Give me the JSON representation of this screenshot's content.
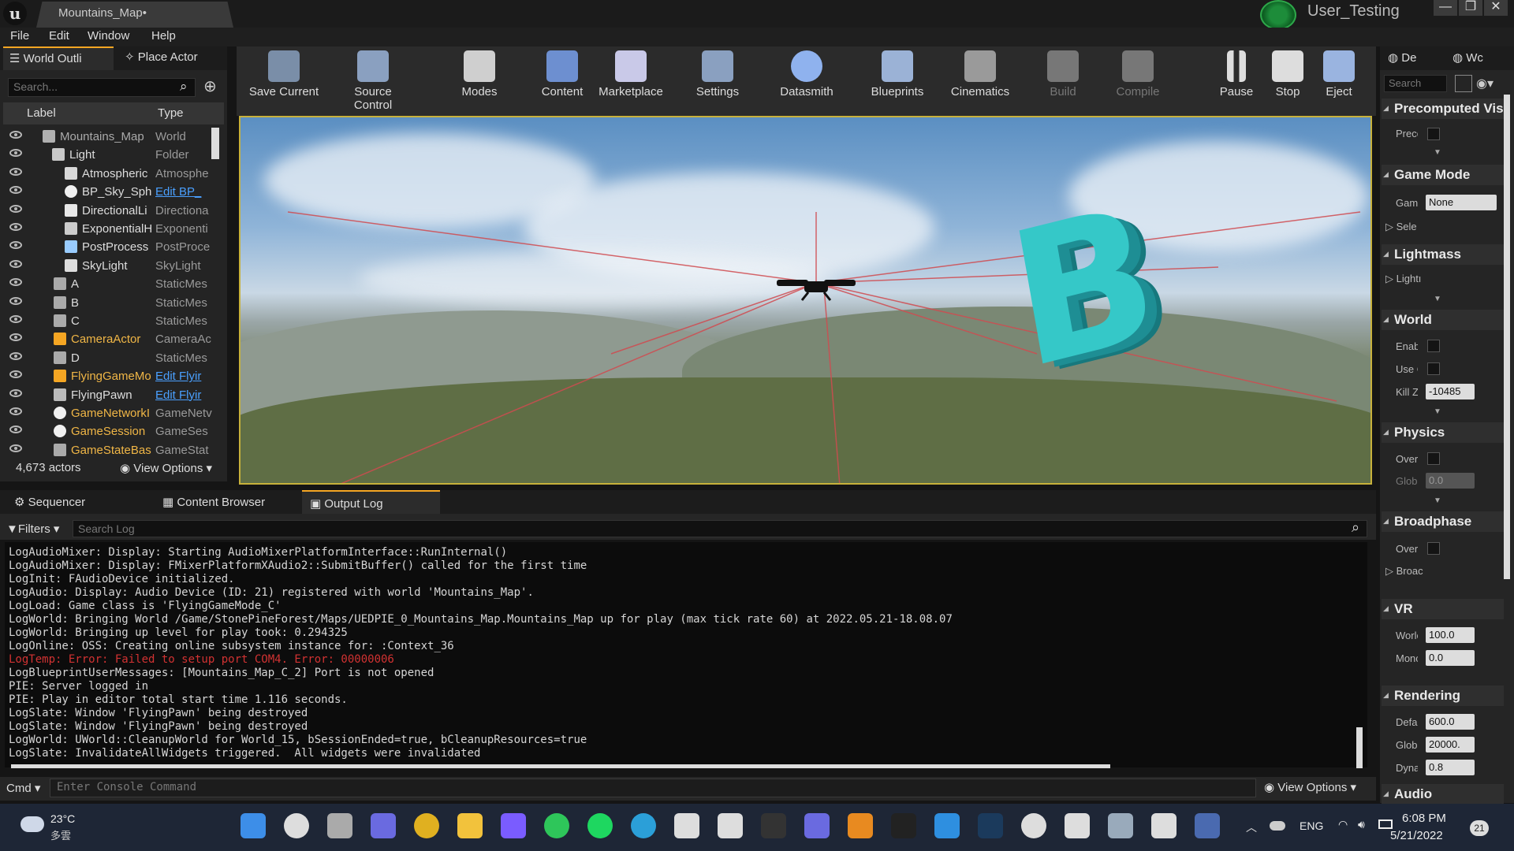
{
  "window": {
    "doc_tab": "Mountains_Map•",
    "user": "User_Testing",
    "minimize": "—",
    "restore": "❐",
    "close": "✕"
  },
  "menu": [
    "File",
    "Edit",
    "Window",
    "Help"
  ],
  "outliner": {
    "tab": "World Outli",
    "tab2": "Place Actor",
    "search_placeholder": "Search...",
    "col_label": "Label",
    "col_type": "Type",
    "rows": [
      {
        "label": "Mountains_Map",
        "type": "World",
        "icon": "world-icon"
      },
      {
        "label": "Light",
        "type": "Folder",
        "icon": "folder-icon"
      },
      {
        "label": "Atmospheric",
        "type": "Atmosphe",
        "icon": "atmosphere-icon"
      },
      {
        "label": "BP_Sky_Sph",
        "type": "Edit BP_",
        "icon": "sphere-icon",
        "link": true
      },
      {
        "label": "DirectionalLi",
        "type": "Directiona",
        "icon": "light-icon"
      },
      {
        "label": "ExponentialH",
        "type": "Exponenti",
        "icon": "fog-icon"
      },
      {
        "label": "PostProcess",
        "type": "PostProce",
        "icon": "postprocess-icon"
      },
      {
        "label": "SkyLight",
        "type": "SkyLight",
        "icon": "skylight-icon"
      },
      {
        "label": "A",
        "type": "StaticMes",
        "icon": "mesh-icon"
      },
      {
        "label": "B",
        "type": "StaticMes",
        "icon": "mesh-icon"
      },
      {
        "label": "C",
        "type": "StaticMes",
        "icon": "mesh-icon"
      },
      {
        "label": "CameraActor",
        "type": "CameraAc",
        "icon": "camera-icon"
      },
      {
        "label": "D",
        "type": "StaticMes",
        "icon": "mesh-icon"
      },
      {
        "label": "FlyingGameMo",
        "type": "Edit Flyir",
        "icon": "gamemode-icon",
        "link": true
      },
      {
        "label": "FlyingPawn",
        "type": "Edit Flyir",
        "icon": "pawn-icon",
        "link": true
      },
      {
        "label": "GameNetworkI",
        "type": "GameNetv",
        "icon": "sphere-icon"
      },
      {
        "label": "GameSession",
        "type": "GameSes",
        "icon": "sphere-icon"
      },
      {
        "label": "GameStateBas",
        "type": "GameStat",
        "icon": "gamestate-icon"
      }
    ],
    "actor_count": "4,673 actors",
    "view_options": "View Options"
  },
  "toolbar": [
    {
      "label": "Save Current",
      "icon": "save-icon"
    },
    {
      "label": "Source Control",
      "icon": "source-control-icon"
    },
    {
      "label": "Modes",
      "icon": "modes-icon"
    },
    {
      "label": "Content",
      "icon": "content-icon"
    },
    {
      "label": "Marketplace",
      "icon": "marketplace-icon"
    },
    {
      "label": "Settings",
      "icon": "settings-icon"
    },
    {
      "label": "Datasmith",
      "icon": "datasmith-icon"
    },
    {
      "label": "Blueprints",
      "icon": "blueprints-icon"
    },
    {
      "label": "Cinematics",
      "icon": "cinematics-icon"
    },
    {
      "label": "Build",
      "icon": "build-icon"
    },
    {
      "label": "Compile",
      "icon": "compile-icon"
    },
    {
      "label": "Pause",
      "icon": "pause-icon"
    },
    {
      "label": "Stop",
      "icon": "stop-icon"
    },
    {
      "label": "Eject",
      "icon": "eject-icon"
    }
  ],
  "details": {
    "tab1": "De",
    "tab2": "Wc",
    "search": "Search",
    "sections": {
      "precomputed": "Precomputed Visi",
      "precomputed_lbl": "Precc",
      "gamemode": "Game Mode",
      "gamemode_lbl": "Gam",
      "gamemode_val": "None",
      "gamemode_sub": "Sele",
      "lightmass": "Lightmass",
      "lightmass_sub": "Lightı",
      "world": "World",
      "world_enable": "Enabl",
      "world_use": "Use C",
      "world_killz": "Kill Z",
      "world_killz_val": "-10485",
      "physics": "Physics",
      "physics_overr": "Overr",
      "physics_globa": "Globa",
      "physics_globa_val": "0.0",
      "broadphase": "Broadphase",
      "broad_overr": "Overr",
      "broad_sub": "Broac",
      "vr": "VR",
      "vr_world": "Worlc",
      "vr_world_val": "100.0",
      "vr_mono": "Monc",
      "vr_mono_val": "0.0",
      "rendering": "Rendering",
      "rend_defa": "Defa",
      "rend_defa_val": "600.0",
      "rend_glob": "Globa",
      "rend_glob_val": "20000.",
      "rend_dyna": "Dyna",
      "rend_dyna_val": "0.8",
      "audio": "Audio"
    }
  },
  "bottom_tabs": [
    "Sequencer",
    "Content Browser",
    "Output Log"
  ],
  "log": {
    "filters": "Filters",
    "search_placeholder": "Search Log",
    "lines": [
      {
        "text": "LogAudioMixer: Display: Starting AudioMixerPlatformInterface::RunInternal()",
        "err": false
      },
      {
        "text": "LogAudioMixer: Display: FMixerPlatformXAudio2::SubmitBuffer() called for the first time",
        "err": false
      },
      {
        "text": "LogInit: FAudioDevice initialized.",
        "err": false
      },
      {
        "text": "LogAudio: Display: Audio Device (ID: 21) registered with world 'Mountains_Map'.",
        "err": false
      },
      {
        "text": "LogLoad: Game class is 'FlyingGameMode_C'",
        "err": false
      },
      {
        "text": "LogWorld: Bringing World /Game/StonePineForest/Maps/UEDPIE_0_Mountains_Map.Mountains_Map up for play (max tick rate 60) at 2022.05.21-18.08.07",
        "err": false
      },
      {
        "text": "LogWorld: Bringing up level for play took: 0.294325",
        "err": false
      },
      {
        "text": "LogOnline: OSS: Creating online subsystem instance for: :Context_36",
        "err": false
      },
      {
        "text": "LogTemp: Error: Failed to setup port COM4. Error: 00000006",
        "err": true
      },
      {
        "text": "LogBlueprintUserMessages: [Mountains_Map_C_2] Port is not opened",
        "err": false
      },
      {
        "text": "PIE: Server logged in",
        "err": false
      },
      {
        "text": "PIE: Play in editor total start time 1.116 seconds.",
        "err": false
      },
      {
        "text": "LogSlate: Window 'FlyingPawn' being destroyed",
        "err": false
      },
      {
        "text": "LogSlate: Window 'FlyingPawn' being destroyed",
        "err": false
      },
      {
        "text": "LogWorld: UWorld::CleanupWorld for World_15, bSessionEnded=true, bCleanupResources=true",
        "err": false
      },
      {
        "text": "LogSlate: InvalidateAllWidgets triggered.  All widgets were invalidated",
        "err": false
      }
    ],
    "cmd": "Cmd",
    "cmd_placeholder": "Enter Console Command",
    "view_options": "View Options"
  },
  "viewport": {
    "letter": "B"
  },
  "taskbar": {
    "temp": "23°C",
    "weather": "多雲",
    "lang": "ENG",
    "time": "6:08 PM",
    "date": "5/21/2022",
    "notif": "21",
    "apps": [
      "start-icon",
      "search-icon",
      "taskview-icon",
      "chat-icon",
      "chrome-icon",
      "explorer-icon",
      "messenger-icon",
      "line-icon",
      "spotify-icon",
      "edge-icon",
      "app-icon",
      "roblox-icon",
      "epic-games-icon",
      "vr-app-icon",
      "folder-app-icon",
      "terminal-icon",
      "vscode-icon",
      "steam-icon",
      "github-icon",
      "game-app-icon",
      "notes-icon",
      "unreal-icon",
      "vr-icon"
    ]
  }
}
